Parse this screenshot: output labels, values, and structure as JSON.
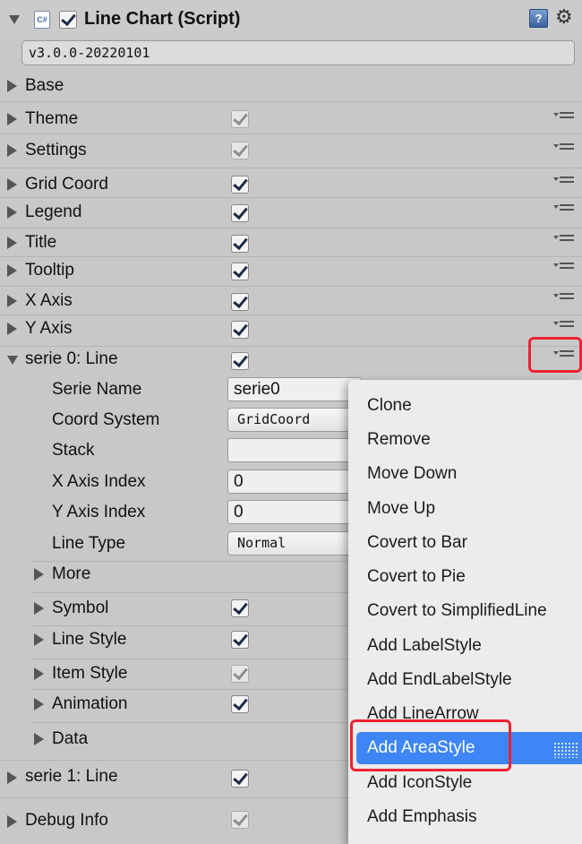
{
  "component": {
    "title": "Line Chart (Script)",
    "version": "v3.0.0-20220101",
    "script_icon": "C#",
    "help_icon": "?",
    "gear_icon": "⚙"
  },
  "sections": {
    "base": "Base",
    "theme": "Theme",
    "settings": "Settings",
    "grid_coord": "Grid Coord",
    "legend": "Legend",
    "title": "Title",
    "tooltip": "Tooltip",
    "x_axis": "X Axis",
    "y_axis": "Y Axis",
    "serie0": "serie 0: Line",
    "serie1": "serie 1: Line",
    "debug_info": "Debug Info"
  },
  "serie0": {
    "serie_name_label": "Serie Name",
    "serie_name_value": "serie0",
    "coord_system_label": "Coord System",
    "coord_system_value": "GridCoord",
    "stack_label": "Stack",
    "stack_value": "",
    "x_axis_index_label": "X Axis Index",
    "x_axis_index_value": "0",
    "y_axis_index_label": "Y Axis Index",
    "y_axis_index_value": "0",
    "line_type_label": "Line Type",
    "line_type_value": "Normal",
    "more": "More",
    "symbol": "Symbol",
    "line_style": "Line Style",
    "item_style": "Item Style",
    "animation": "Animation",
    "data": "Data"
  },
  "context_menu": {
    "items": [
      "Clone",
      "Remove",
      "Move Down",
      "Move Up",
      "Covert to Bar",
      "Covert to Pie",
      "Covert to SimplifiedLine",
      "Add LabelStyle",
      "Add EndLabelStyle",
      "Add LineArrow",
      "Add AreaStyle",
      "Add IconStyle",
      "Add Emphasis"
    ],
    "selected": "Add AreaStyle"
  },
  "colors": {
    "highlight": "#ee2233",
    "selection": "#3e86f5",
    "panel": "#c8c8c8"
  }
}
